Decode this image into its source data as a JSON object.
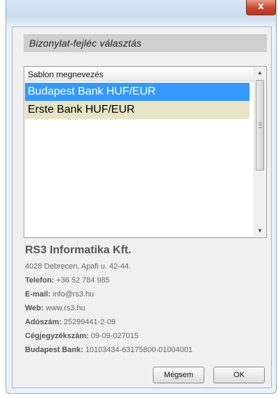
{
  "window": {
    "close_label": "x",
    "header": "Bizonylat-fejléc választás"
  },
  "list": {
    "column_header": "Sablon megnevezés",
    "items": [
      {
        "label": "Budapest Bank HUF/EUR",
        "selected": true
      },
      {
        "label": "Erste Bank HUF/EUR",
        "selected": false
      }
    ]
  },
  "company": {
    "name": "RS3 Informatika Kft.",
    "address": "4028 Debrecen, Apafi u. 42-44.",
    "phone_label": "Telefon:",
    "phone": "+36 52 784 985",
    "email_label": "E-mail:",
    "email": "info@rs3.hu",
    "web_label": "Web:",
    "web": "www.rs3.hu",
    "tax_label": "Adószám:",
    "tax": "25299441-2-09",
    "reg_label": "Cégjegyzékszám:",
    "reg": "09-09-027015",
    "bank_label": "Budapest Bank:",
    "bank": "10103434-63175800-01004001"
  },
  "buttons": {
    "cancel": "Mégsem",
    "ok": "OK"
  },
  "colors": {
    "selection": "#3399ff",
    "alt_row": "#e8e3c4",
    "header_band": "#cfcfcf",
    "close": "#c8462e"
  }
}
